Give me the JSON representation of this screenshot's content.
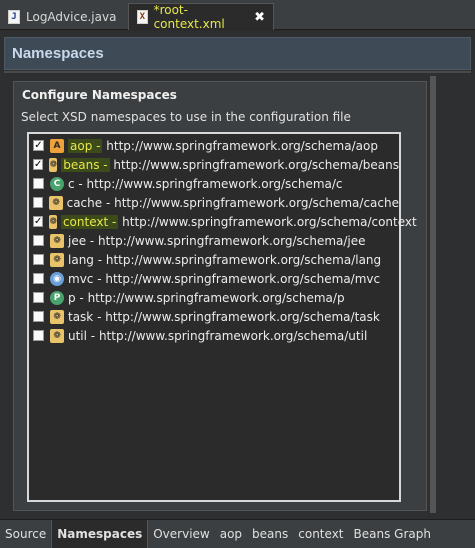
{
  "editor_tabs": [
    {
      "label": "LogAdvice.java",
      "icon": "java-file-icon"
    },
    {
      "label": "*root-context.xml",
      "icon": "xml-file-icon",
      "close": "✖"
    }
  ],
  "header": {
    "title": "Namespaces"
  },
  "section": {
    "title": "Configure Namespaces",
    "description": "Select XSD namespaces to use in the configuration file"
  },
  "namespaces": [
    {
      "label": "aop - http://www.springframework.org/schema/aop",
      "checked": true,
      "icon": "aop-icon",
      "highlight": true
    },
    {
      "label": "beans - http://www.springframework.org/schema/beans",
      "checked": true,
      "icon": "bean-icon",
      "highlight": true
    },
    {
      "label": "c - http://www.springframework.org/schema/c",
      "checked": false,
      "icon": "c-icon"
    },
    {
      "label": "cache - http://www.springframework.org/schema/cache",
      "checked": false,
      "icon": "bean-icon"
    },
    {
      "label": "context - http://www.springframework.org/schema/context",
      "checked": true,
      "icon": "bean-icon",
      "highlight": true
    },
    {
      "label": "jee - http://www.springframework.org/schema/jee",
      "checked": false,
      "icon": "bean-icon"
    },
    {
      "label": "lang - http://www.springframework.org/schema/lang",
      "checked": false,
      "icon": "bean-icon"
    },
    {
      "label": "mvc - http://www.springframework.org/schema/mvc",
      "checked": false,
      "icon": "mvc-icon"
    },
    {
      "label": "p - http://www.springframework.org/schema/p",
      "checked": false,
      "icon": "p-icon"
    },
    {
      "label": "task - http://www.springframework.org/schema/task",
      "checked": false,
      "icon": "bean-icon"
    },
    {
      "label": "util - http://www.springframework.org/schema/util",
      "checked": false,
      "icon": "bean-icon"
    }
  ],
  "bottom_tabs": [
    "Source",
    "Namespaces",
    "Overview",
    "aop",
    "beans",
    "context",
    "Beans Graph"
  ],
  "active_bottom_tab": "Namespaces",
  "colors": {
    "highlight": "#e6e84a",
    "header_bg": "#3e4a55",
    "header_text": "#c7d9ea"
  }
}
